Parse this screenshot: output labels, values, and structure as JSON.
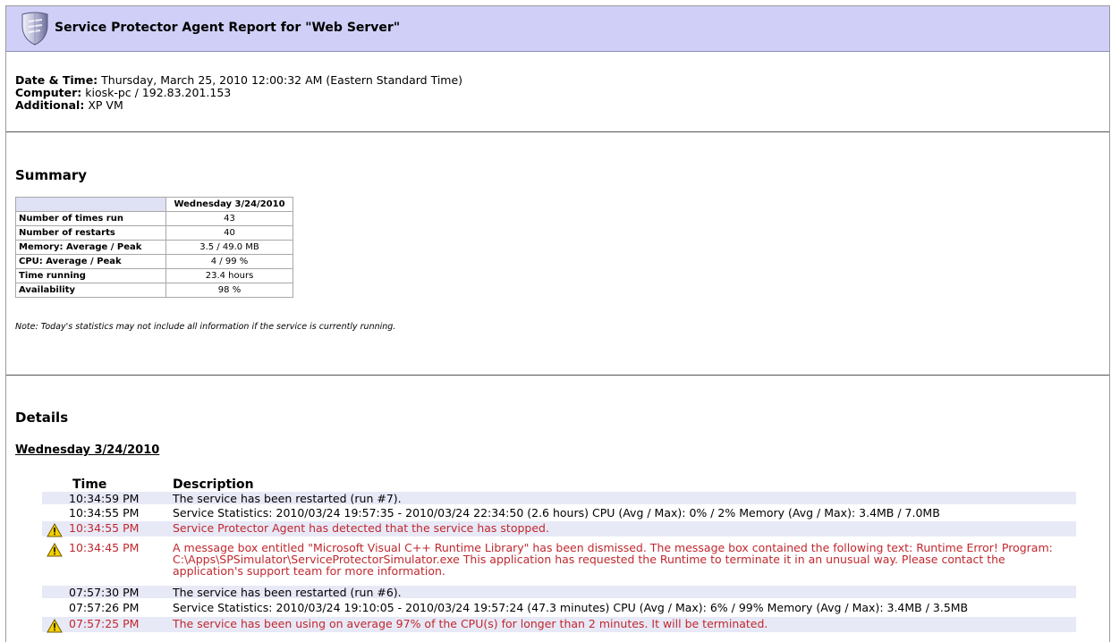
{
  "header": {
    "title": "Service Protector Agent Report for \"Web Server\"",
    "icon": "shield-icon"
  },
  "meta": {
    "datetime_label": "Date & Time:",
    "datetime_value": "Thursday, March 25, 2010 12:00:32 AM (Eastern Standard Time)",
    "computer_label": "Computer:",
    "computer_value": "kiosk-pc / 192.83.201.153",
    "additional_label": "Additional:",
    "additional_value": "XP VM"
  },
  "summary": {
    "title": "Summary",
    "column_header": "Wednesday 3/24/2010",
    "rows": [
      {
        "label": "Number of times run",
        "value": "43"
      },
      {
        "label": "Number of restarts",
        "value": "40"
      },
      {
        "label": "Memory: Average / Peak",
        "value": "3.5 / 49.0 MB"
      },
      {
        "label": "CPU: Average / Peak",
        "value": "4 / 99 %"
      },
      {
        "label": "Time running",
        "value": "23.4 hours"
      },
      {
        "label": "Availability",
        "value": "98 %"
      }
    ],
    "note": "Note: Today's statistics may not include all information if the service is currently running."
  },
  "details": {
    "title": "Details",
    "day": "Wednesday 3/24/2010",
    "time_header": "Time",
    "desc_header": "Description",
    "rows": [
      {
        "time": "10:34:59 PM",
        "desc": "The service has been restarted (run #7).",
        "error": false
      },
      {
        "time": "10:34:55 PM",
        "desc": "Service Statistics: 2010/03/24 19:57:35 - 2010/03/24 22:34:50 (2.6 hours) CPU (Avg / Max): 0% / 2% Memory (Avg / Max): 3.4MB / 7.0MB",
        "error": false
      },
      {
        "time": "10:34:55 PM",
        "desc": "Service Protector Agent has detected that the service has stopped.",
        "error": true
      },
      {
        "time": "10:34:45 PM",
        "desc": "A message box entitled \"Microsoft Visual C++ Runtime Library\" has been dismissed. The message box contained the following text: Runtime Error! Program: C:\\Apps\\SPSimulator\\ServiceProtectorSimulator.exe This application has requested the Runtime to terminate it in an unusual way. Please contact the application's support team for more information.",
        "error": true
      },
      {
        "time": "07:57:30 PM",
        "desc": "The service has been restarted (run #6).",
        "error": false
      },
      {
        "time": "07:57:26 PM",
        "desc": "Service Statistics: 2010/03/24 19:10:05 - 2010/03/24 19:57:24 (47.3 minutes) CPU (Avg / Max): 6% / 99% Memory (Avg / Max): 3.4MB / 3.5MB",
        "error": false
      },
      {
        "time": "07:57:25 PM",
        "desc": "The service has been using on average 97% of the CPU(s) for longer than 2 minutes. It will be terminated.",
        "error": true
      }
    ]
  },
  "colors": {
    "header_bg": "#cfcff7",
    "row_shade": "#e8e9f7",
    "error_text": "#c0282e",
    "warning_icon": "#f5d000"
  }
}
